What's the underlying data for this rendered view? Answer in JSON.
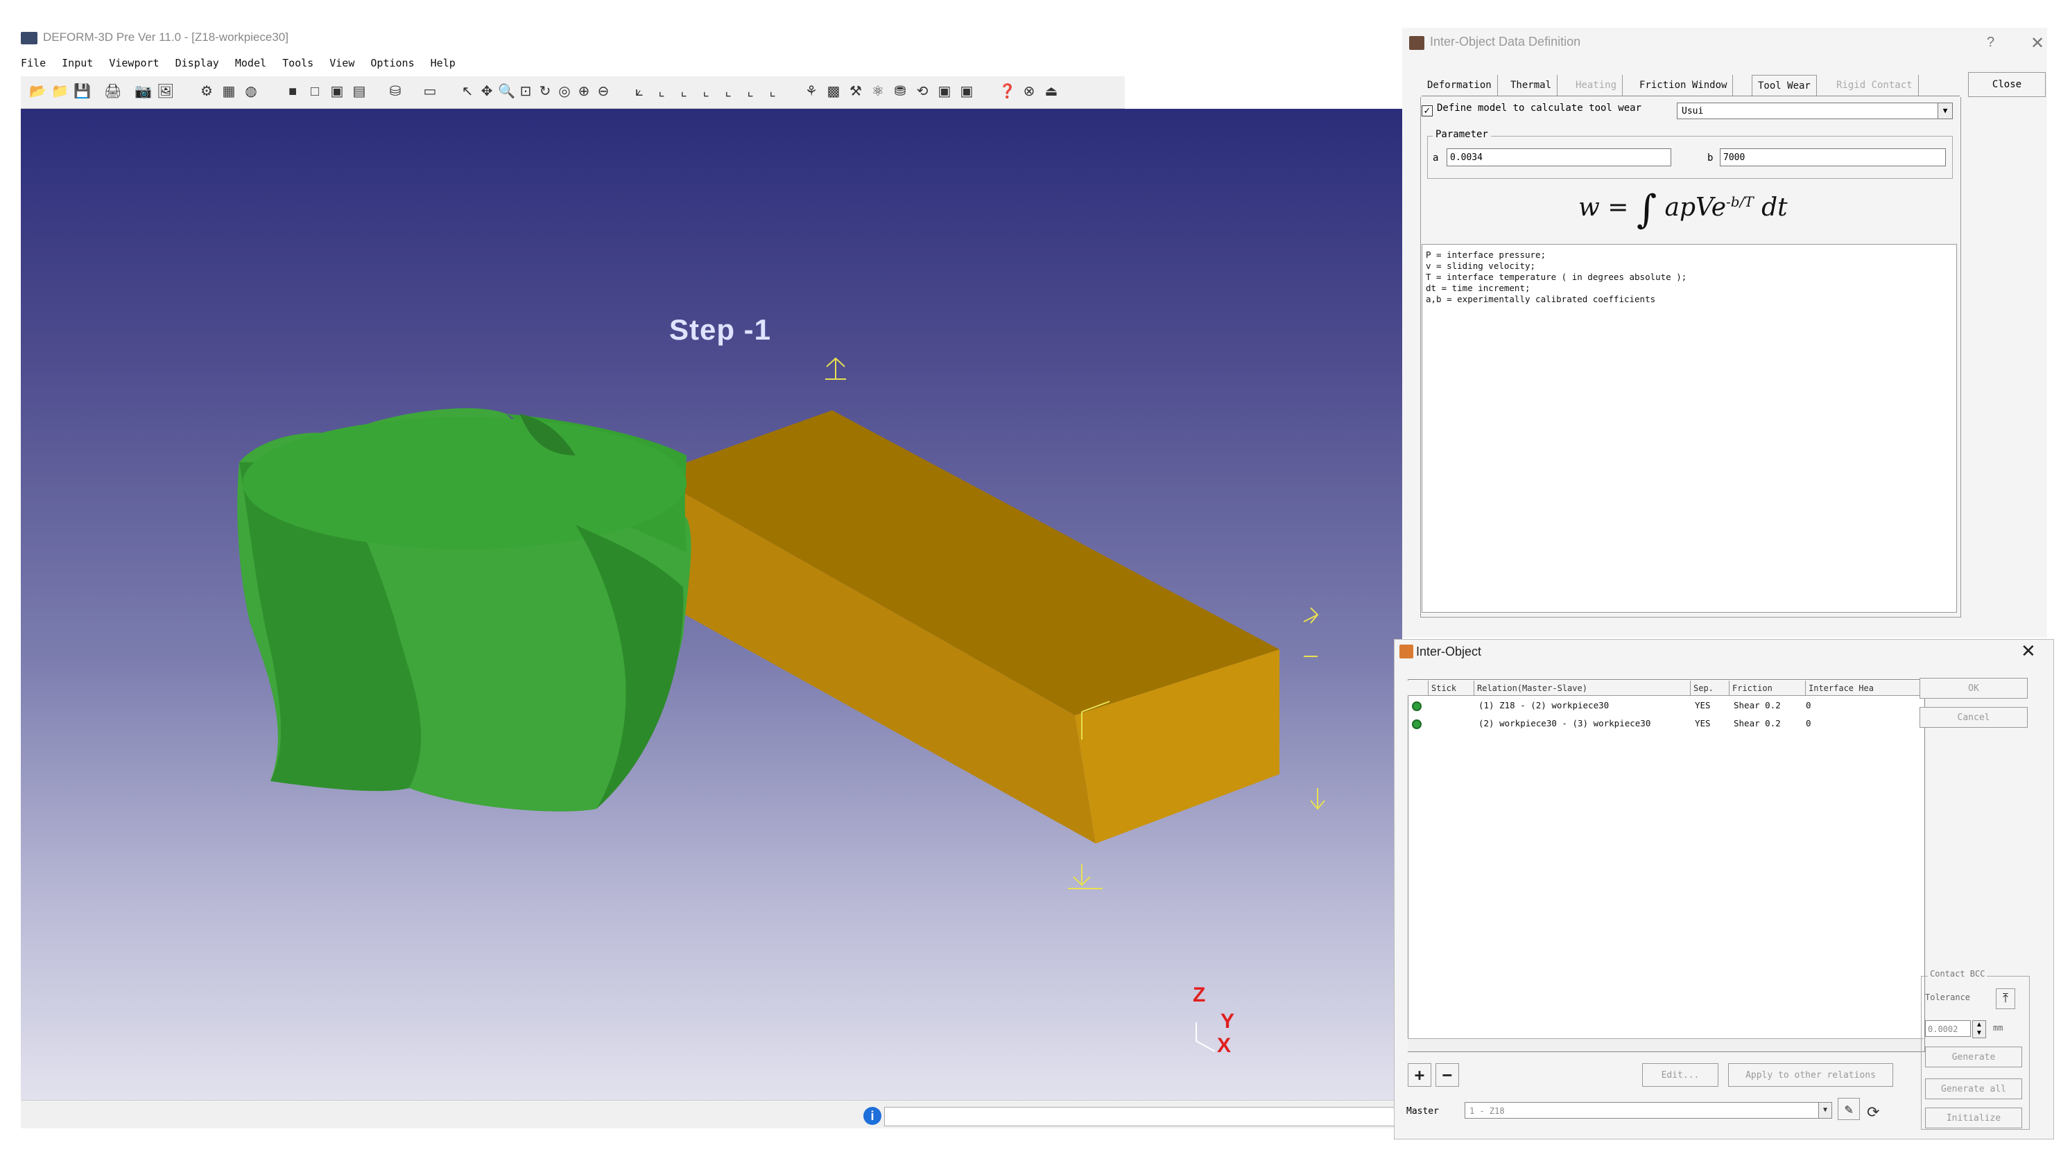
{
  "app": {
    "title": "DEFORM-3D Pre Ver 11.0 - [Z18-workpiece30]",
    "menu": [
      "File",
      "Input",
      "Viewport",
      "Display",
      "Model",
      "Tools",
      "View",
      "Options",
      "Help"
    ]
  },
  "viewport": {
    "step_label": "Step   -1",
    "axes": {
      "z": "Z",
      "y": "Y",
      "x": "X"
    },
    "tool_color": "#3aa33a",
    "workpiece_color": "#c28a00"
  },
  "dialog_main": {
    "title": "Inter-Object Data Definition",
    "help": "?",
    "close_x": "✕",
    "tabs": [
      {
        "label": "Deformation",
        "enabled": true
      },
      {
        "label": "Thermal",
        "enabled": true
      },
      {
        "label": "Heating",
        "enabled": false
      },
      {
        "label": "Friction Window",
        "enabled": true
      },
      {
        "label": "Tool Wear",
        "enabled": true
      },
      {
        "label": "Rigid Contact",
        "enabled": false
      }
    ],
    "close_label": "Close",
    "checkbox_mark": "✓",
    "define_model_label": "Define model to calculate tool wear",
    "model_value": "Usui",
    "parameter_legend": "Parameter",
    "a_label": "a",
    "a_value": "0.0034",
    "b_label": "b",
    "b_value": "7000",
    "formula_lhs": "w =",
    "formula_rhs": "apVe",
    "formula_exp": "-b/T",
    "formula_dt": "dt",
    "description": [
      "P = interface pressure;",
      "v = sliding velocity;",
      "T = interface temperature ( in degrees absolute );",
      "dt = time increment;",
      "a,b = experimentally calibrated coefficients"
    ]
  },
  "dialog_inter": {
    "title": "Inter-Object",
    "close_x": "✕",
    "columns": [
      "Stick",
      "Relation(Master-Slave)",
      "Sep.",
      "Friction",
      "Interface Hea"
    ],
    "rows": [
      {
        "relation": "(1) Z18 - (2) workpiece30",
        "sep": "YES",
        "friction": "Shear 0.2",
        "heat": "0"
      },
      {
        "relation": "(2) workpiece30 - (3) workpiece30",
        "sep": "YES",
        "friction": "Shear 0.2",
        "heat": "0"
      }
    ],
    "ok_label": "OK",
    "cancel_label": "Cancel",
    "add_label": "+",
    "remove_label": "−",
    "edit_label": "Edit...",
    "apply_label": "Apply to other relations",
    "contact_legend": "Contact BCC",
    "tolerance_label": "Tolerance",
    "tolerance_value": "0.0002",
    "tolerance_unit": "mm",
    "generate_label": "Generate",
    "generate_all_label": "Generate all",
    "initialize_label": "Initialize",
    "master_label": "Master",
    "master_value": "1 - Z18"
  }
}
